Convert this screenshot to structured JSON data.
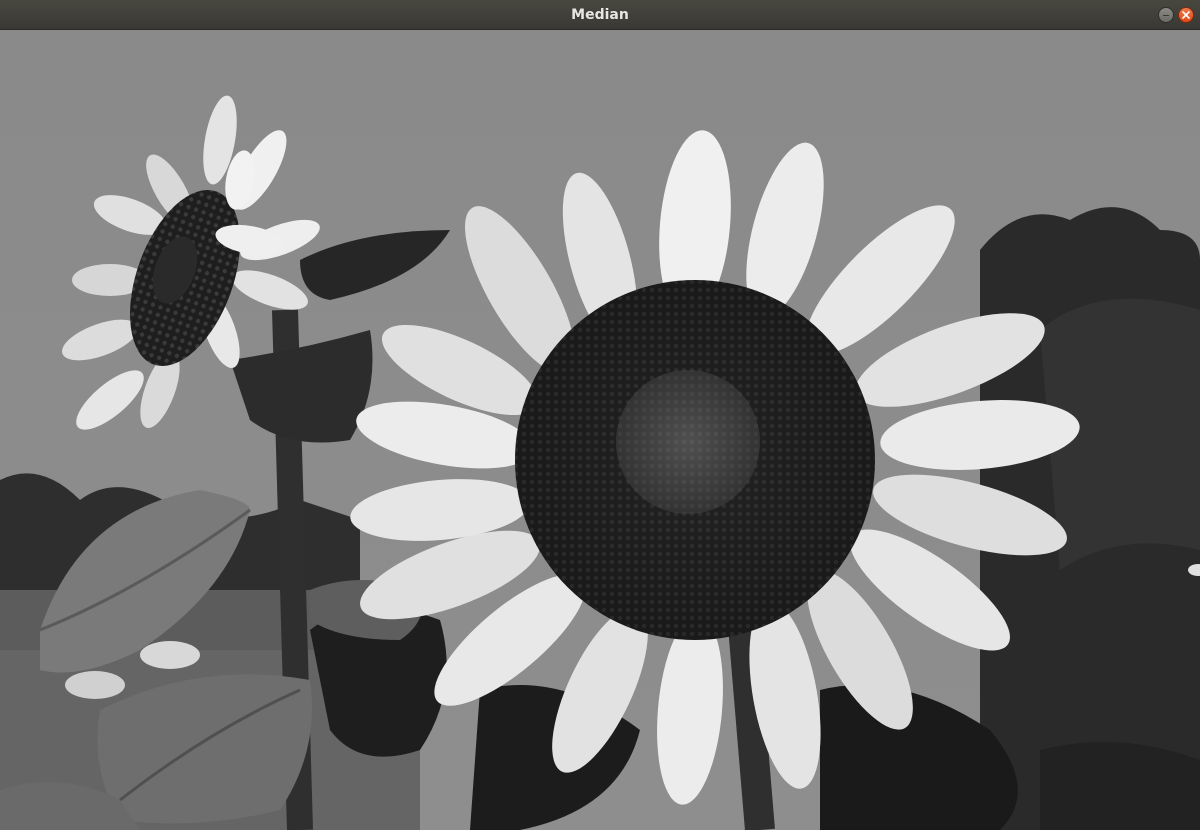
{
  "window": {
    "title": "Median",
    "controls": {
      "minimize_icon": "minimize-icon",
      "close_icon": "close-icon"
    },
    "accent_close": "#e9541e"
  },
  "image": {
    "subject": "sunflower-photo",
    "mode": "grayscale"
  }
}
